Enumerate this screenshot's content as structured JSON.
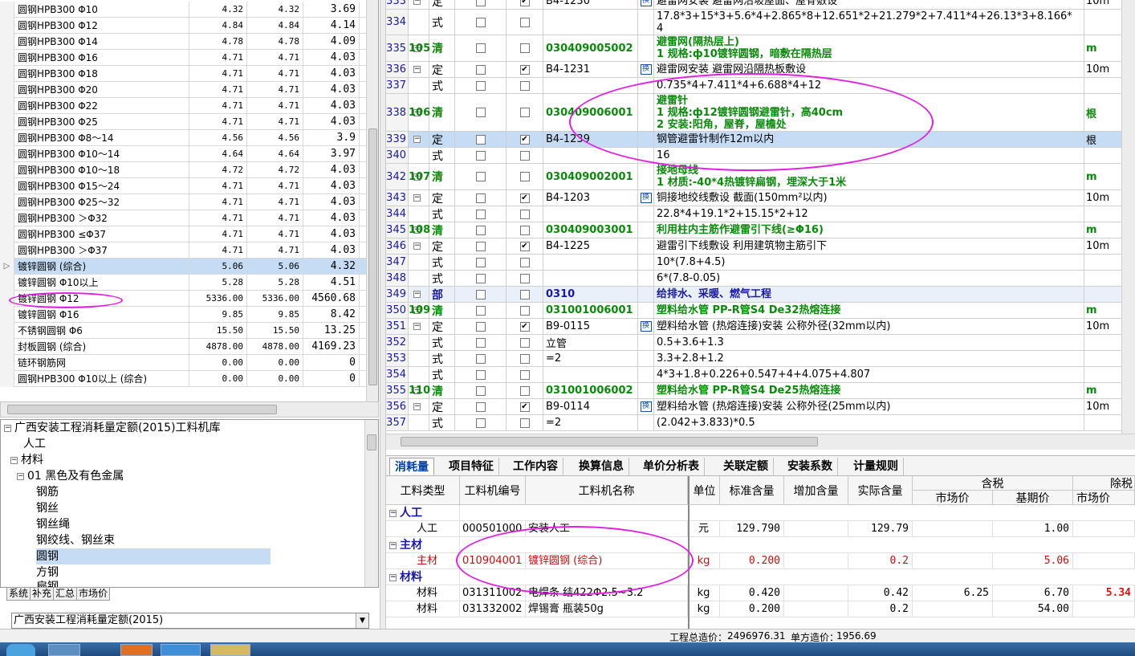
{
  "materials": [
    {
      "name": "圆钢HPB300 Φ10",
      "v1": "4.32",
      "v2": "4.32",
      "v3": "3.69"
    },
    {
      "name": "圆钢HPB300 Φ12",
      "v1": "4.84",
      "v2": "4.84",
      "v3": "4.14"
    },
    {
      "name": "圆钢HPB300 Φ14",
      "v1": "4.78",
      "v2": "4.78",
      "v3": "4.09"
    },
    {
      "name": "圆钢HPB300 Φ16",
      "v1": "4.71",
      "v2": "4.71",
      "v3": "4.03"
    },
    {
      "name": "圆钢HPB300 Φ18",
      "v1": "4.71",
      "v2": "4.71",
      "v3": "4.03"
    },
    {
      "name": "圆钢HPB300 Φ20",
      "v1": "4.71",
      "v2": "4.71",
      "v3": "4.03"
    },
    {
      "name": "圆钢HPB300 Φ22",
      "v1": "4.71",
      "v2": "4.71",
      "v3": "4.03"
    },
    {
      "name": "圆钢HPB300 Φ25",
      "v1": "4.71",
      "v2": "4.71",
      "v3": "4.03"
    },
    {
      "name": "圆钢HPB300 Φ8～14",
      "v1": "4.56",
      "v2": "4.56",
      "v3": "3.9"
    },
    {
      "name": "圆钢HPB300 Φ10～14",
      "v1": "4.64",
      "v2": "4.64",
      "v3": "3.97"
    },
    {
      "name": "圆钢HPB300 Φ10～18",
      "v1": "4.72",
      "v2": "4.72",
      "v3": "4.03"
    },
    {
      "name": "圆钢HPB300 Φ15～24",
      "v1": "4.71",
      "v2": "4.71",
      "v3": "4.03"
    },
    {
      "name": "圆钢HPB300 Φ25～32",
      "v1": "4.71",
      "v2": "4.71",
      "v3": "4.03"
    },
    {
      "name": "圆钢HPB300 ＞Φ32",
      "v1": "4.71",
      "v2": "4.71",
      "v3": "4.03"
    },
    {
      "name": "圆钢HPB300 ≤Φ37",
      "v1": "4.71",
      "v2": "4.71",
      "v3": "4.03"
    },
    {
      "name": "圆钢HPB300 ＞Φ37",
      "v1": "4.71",
      "v2": "4.71",
      "v3": "4.03"
    },
    {
      "name": "镀锌圆钢 (综合)",
      "v1": "5.06",
      "v2": "5.06",
      "v3": "4.32"
    },
    {
      "name": "镀锌圆钢 Φ10以上",
      "v1": "5.28",
      "v2": "5.28",
      "v3": "4.51"
    },
    {
      "name": "镀锌圆钢 Φ12",
      "v1": "5336.00",
      "v2": "5336.00",
      "v3": "4560.68"
    },
    {
      "name": "镀锌圆钢 Φ16",
      "v1": "9.85",
      "v2": "9.85",
      "v3": "8.42"
    },
    {
      "name": "不锈钢圆钢 Φ6",
      "v1": "15.50",
      "v2": "15.50",
      "v3": "13.25"
    },
    {
      "name": "封板圆钢 (综合)",
      "v1": "4878.00",
      "v2": "4878.00",
      "v3": "4169.23"
    },
    {
      "name": "链环钢筋网",
      "v1": "0.00",
      "v2": "0.00",
      "v3": "0"
    },
    {
      "name": "圆钢HPB300 Φ10以上 (综合)",
      "v1": "0.00",
      "v2": "0.00",
      "v3": "0"
    }
  ],
  "tree": {
    "root": "广西安装工程消耗量定额(2015)工料机库",
    "labor": "人工",
    "material": "材料",
    "group": "01  黑色及有色金属",
    "items": [
      "钢筋",
      "钢丝",
      "钢丝绳",
      "钢绞线、钢丝束",
      "圆钢",
      "方钢",
      "扁钢"
    ]
  },
  "left_tabs": [
    "系统",
    "补充",
    "汇总",
    "市场价"
  ],
  "library_select": "广西安装工程消耗量定额(2015)",
  "grid": [
    {
      "no": "333",
      "type": "定",
      "code": "B4-1230",
      "chk": true,
      "mark": true,
      "name": [
        "避雷网安装  避雷网沿坡屋面、屋脊敷设"
      ],
      "unit": "10m",
      "cls": ""
    },
    {
      "no": "334",
      "type": "式",
      "code": "",
      "chk": false,
      "mark": false,
      "name": [
        "17.8*3+15*3+5.6*4+2.865*8+12.651*2+21.279*2+7.411*4+26.13*3+8.166*",
        "4"
      ],
      "unit": "",
      "cls": "",
      "h": 32
    },
    {
      "no": "335",
      "type": "清",
      "code": "030409005002",
      "seq": "105",
      "chk": false,
      "mark": false,
      "name": [
        "避雷网(隔热层上)",
        "1 规格:ф10镀锌圆钢，暗敷在隔热层"
      ],
      "unit": "m",
      "cls": "qing",
      "h": 33
    },
    {
      "no": "336",
      "type": "定",
      "code": "B4-1231",
      "chk": true,
      "mark": true,
      "name": [
        "避雷网安装  避雷网沿隔热板敷设"
      ],
      "unit": "10m",
      "cls": ""
    },
    {
      "no": "337",
      "type": "式",
      "code": "",
      "chk": false,
      "mark": false,
      "name": [
        "0.735*4+7.411*4+6.688*4+12"
      ],
      "unit": "",
      "cls": ""
    },
    {
      "no": "338",
      "type": "清",
      "code": "030409006001",
      "seq": "106",
      "chk": false,
      "mark": false,
      "name": [
        "避雷针",
        "1 规格:ф12镀锌圆钢避雷针，高40cm",
        "2 安装:阳角，屋脊，屋檐处"
      ],
      "unit": "根",
      "cls": "qing",
      "h": 47
    },
    {
      "no": "339",
      "type": "定",
      "code": "B4-1239",
      "chk": true,
      "mark": false,
      "name": [
        "钢管避雷针制作12m以内"
      ],
      "unit": "根",
      "cls": "sel"
    },
    {
      "no": "340",
      "type": "式",
      "code": "",
      "chk": false,
      "mark": false,
      "name": [
        "16"
      ],
      "unit": "",
      "cls": ""
    },
    {
      "no": "342",
      "type": "清",
      "code": "030409002001",
      "seq": "107",
      "chk": false,
      "mark": false,
      "name": [
        "接地母线",
        "1 材质:-40*4热镀锌扁钢，埋深大于1米"
      ],
      "unit": "m",
      "cls": "qing",
      "h": 33
    },
    {
      "no": "343",
      "type": "定",
      "code": "B4-1203",
      "chk": true,
      "mark": true,
      "name": [
        "铜接地绞线敷设  截面(150mm²以内)"
      ],
      "unit": "10m",
      "cls": ""
    },
    {
      "no": "344",
      "type": "式",
      "code": "",
      "chk": false,
      "mark": false,
      "name": [
        "22.8*4+19.1*2+15.15*2+12"
      ],
      "unit": "",
      "cls": ""
    },
    {
      "no": "345",
      "type": "清",
      "code": "030409003001",
      "seq": "108",
      "chk": false,
      "mark": false,
      "name": [
        "利用柱内主筋作避雷引下线(≥Φ16)"
      ],
      "unit": "m",
      "cls": "qing"
    },
    {
      "no": "346",
      "type": "定",
      "code": "B4-1225",
      "chk": true,
      "mark": false,
      "name": [
        "避雷引下线敷设  利用建筑物主筋引下"
      ],
      "unit": "10m",
      "cls": ""
    },
    {
      "no": "347",
      "type": "式",
      "code": "",
      "chk": false,
      "mark": false,
      "name": [
        "10*(7.8+4.5)"
      ],
      "unit": "",
      "cls": ""
    },
    {
      "no": "348",
      "type": "式",
      "code": "",
      "chk": false,
      "mark": false,
      "name": [
        "6*(7.8-0.05)"
      ],
      "unit": "",
      "cls": ""
    },
    {
      "no": "349",
      "type": "部",
      "code": "0310",
      "chk": false,
      "mark": false,
      "name": [
        "给排水、采暖、燃气工程"
      ],
      "unit": "",
      "cls": "bu"
    },
    {
      "no": "350",
      "type": "清",
      "code": "031001006001",
      "seq": "109",
      "chk": false,
      "mark": false,
      "name": [
        "塑料给水管  PP-R管S4  De32热熔连接"
      ],
      "unit": "m",
      "cls": "qing"
    },
    {
      "no": "351",
      "type": "定",
      "code": "B9-0115",
      "chk": true,
      "mark": true,
      "name": [
        "塑料给水管 (热熔连接)安装  公称外径(32mm以内)"
      ],
      "unit": "10m",
      "cls": ""
    },
    {
      "no": "352",
      "type": "式",
      "code": "立管",
      "chk": false,
      "mark": false,
      "name": [
        "0.5+3.6+1.3"
      ],
      "unit": "",
      "cls": ""
    },
    {
      "no": "353",
      "type": "式",
      "code": "=2",
      "chk": false,
      "mark": false,
      "name": [
        "3.3+2.8+1.2"
      ],
      "unit": "",
      "cls": ""
    },
    {
      "no": "354",
      "type": "式",
      "code": "",
      "chk": false,
      "mark": false,
      "name": [
        "4*3+1.8+0.226+0.547+4+4.075+4.807"
      ],
      "unit": "",
      "cls": ""
    },
    {
      "no": "355",
      "type": "清",
      "code": "031001006002",
      "seq": "110",
      "chk": false,
      "mark": false,
      "name": [
        "塑料给水管  PP-R管S4  De25热熔连接"
      ],
      "unit": "m",
      "cls": "qing"
    },
    {
      "no": "356",
      "type": "定",
      "code": "B9-0114",
      "chk": true,
      "mark": true,
      "name": [
        "塑料给水管 (热熔连接)安装  公称外径(25mm以内)"
      ],
      "unit": "10m",
      "cls": ""
    },
    {
      "no": "357",
      "type": "式",
      "code": "=2",
      "chk": false,
      "mark": false,
      "name": [
        "(2.042+3.833)*0.5"
      ],
      "unit": "",
      "cls": ""
    }
  ],
  "tabs": [
    "消耗量",
    "项目特征",
    "工作内容",
    "换算信息",
    "单价分析表",
    "关联定额",
    "安装系数",
    "计量规则"
  ],
  "bottom_headers": {
    "type": "工料类型",
    "code": "工料机编号",
    "name": "工料机名称",
    "unit": "单位",
    "std": "标准含量",
    "add": "增加含量",
    "actual": "实际含量",
    "tax": "含税",
    "market": "市场价",
    "base": "基期价",
    "notax": "除税",
    "market2": "市场价"
  },
  "bottom_rows": [
    {
      "grp": true,
      "type": "人工"
    },
    {
      "type": "人工",
      "code": "000501000",
      "name": "安装人工",
      "unit": "元",
      "std": "129.790",
      "add": "",
      "actual": "129.79",
      "market": "",
      "base": "1.00",
      "m2": ""
    },
    {
      "grp": true,
      "type": "主材"
    },
    {
      "main": true,
      "type": "主材",
      "code": "010904001",
      "name": "镀锌圆钢 (综合)",
      "unit": "kg",
      "std": "0.200",
      "add": "",
      "actual": "0.2",
      "market": "",
      "base": "5.06",
      "m2": ""
    },
    {
      "grp": true,
      "type": "材料"
    },
    {
      "type": "材料",
      "code": "031311002",
      "name": "电焊条  结422Φ2.5~3.2",
      "unit": "kg",
      "std": "0.420",
      "add": "",
      "actual": "0.42",
      "market": "6.25",
      "base": "6.70",
      "m2": "5.34"
    },
    {
      "type": "材料",
      "code": "031332002",
      "name": "焊锡膏  瓶装50g",
      "unit": "kg",
      "std": "0.200",
      "add": "",
      "actual": "0.2",
      "market": "",
      "base": "54.00",
      "m2": ""
    }
  ],
  "status": {
    "total_label": "工程总造价：",
    "total": "2496976.31",
    "unit_label": "单方造价：",
    "unit_price": "1956.69"
  },
  "colors": {
    "annotation": "#e020e0",
    "selected": "#c6dcf5",
    "qing": "#0a8a0a",
    "bu": "#1a1aa0",
    "main": "#c81010"
  }
}
